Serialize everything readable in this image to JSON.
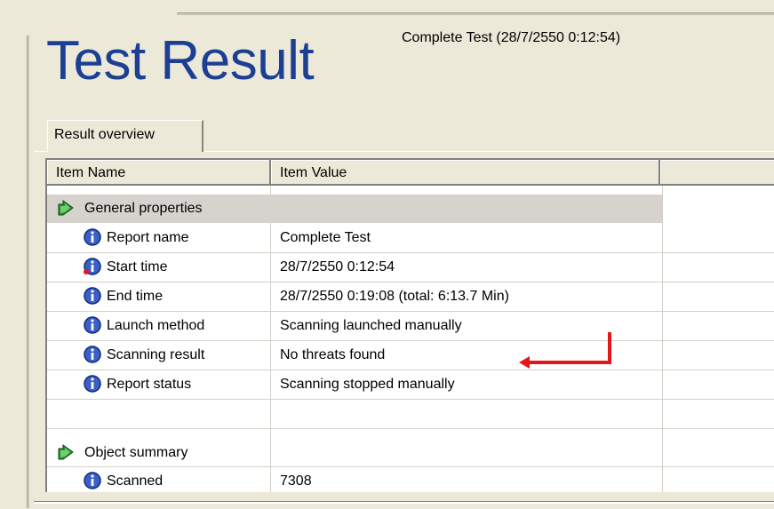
{
  "header": {
    "title": "Test Result",
    "subtitle": "Complete Test (28/7/2550 0:12:54)"
  },
  "tabs": [
    {
      "label": "Result overview",
      "active": true
    }
  ],
  "table": {
    "columns": [
      "Item Name",
      "Item Value",
      ""
    ],
    "sections": [
      {
        "label": "General properties",
        "icon": "green-arrow-icon",
        "items": [
          {
            "name": "Report name",
            "value": "Complete Test",
            "icon": "info-icon"
          },
          {
            "name": "Start time",
            "value": "28/7/2550 0:12:54",
            "icon": "info-icon"
          },
          {
            "name": "End time",
            "value": "28/7/2550 0:19:08  (total: 6:13.7 Min)",
            "icon": "info-icon"
          },
          {
            "name": "Launch method",
            "value": "Scanning launched manually",
            "icon": "info-icon"
          },
          {
            "name": "Scanning result",
            "value": "No threats found",
            "icon": "info-icon"
          },
          {
            "name": "Report status",
            "value": "Scanning stopped manually",
            "icon": "info-icon"
          }
        ]
      },
      {
        "label": "Object summary",
        "icon": "green-arrow-icon",
        "items": [
          {
            "name": "Scanned",
            "value": "7308",
            "icon": "info-icon"
          }
        ]
      }
    ]
  },
  "annotation": {
    "type": "red-arrow-pointer",
    "color": "#e4151b"
  },
  "colors": {
    "title": "#1c3f94",
    "section_bg": "#d6d3ce",
    "window_bg": "#ece9d8"
  }
}
